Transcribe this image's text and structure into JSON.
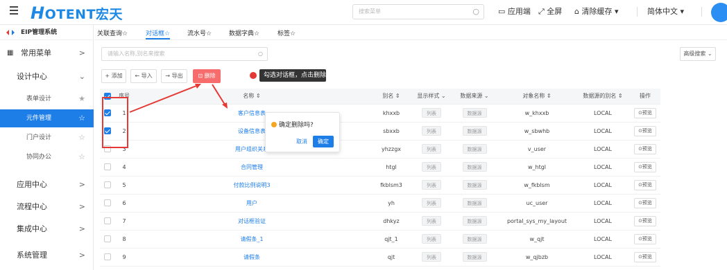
{
  "topbar": {
    "logo": "OTENT宏天",
    "logo_h": "H",
    "search_placeholder": "搜索菜单",
    "app_end": "应用端",
    "fullscreen": "全屏",
    "clear_cache": "清除缓存",
    "language": "简体中文"
  },
  "sidebar": {
    "system": "EIP管理系统",
    "common_menu": "常用菜单",
    "design_center": "设计中心",
    "items": [
      "表单设计",
      "元件管理",
      "门户设计",
      "协同办公"
    ],
    "app_center": "应用中心",
    "flow_center": "流程中心",
    "integration_center": "集成中心",
    "system_mgmt": "系统管理"
  },
  "tabs": [
    "关联查询☆",
    "对话框☆",
    "流水号☆",
    "数据字典☆",
    "标签☆"
  ],
  "toolbar": {
    "filter_placeholder": "请输入名称,别名来搜索",
    "advanced_search": "高级搜索",
    "add": "+ 添加",
    "import": "← 导入",
    "export": "→ 导出",
    "delete": "删除",
    "tooltip": "勾选对话框，点击删除"
  },
  "popconfirm": {
    "question": "确定删除吗?",
    "cancel": "取消",
    "ok": "确定"
  },
  "table": {
    "headers": [
      "序号",
      "名称 ⇕",
      "别名 ⇕",
      "显示样式 ⌄",
      "数据来源 ⌄",
      "对象名称 ⇕",
      "数据源的别名 ⇕",
      "操作"
    ],
    "rows": [
      {
        "no": "1",
        "name": "客户信息表",
        "alias": "khxxb",
        "style": "列表",
        "source": "数据源",
        "obj": "w_khxxb",
        "ds": "LOCAL",
        "op": "⊙预览",
        "checked": true
      },
      {
        "no": "2",
        "name": "设备信息表",
        "alias": "sbxxb",
        "style": "列表",
        "source": "数据源",
        "obj": "w_sbwhb",
        "ds": "LOCAL",
        "op": "⊙预览",
        "checked": true
      },
      {
        "no": "3",
        "name": "用户组织关系",
        "alias": "yhzzgx",
        "style": "列表",
        "source": "数据源",
        "obj": "v_user",
        "ds": "LOCAL",
        "op": "⊙预览",
        "checked": false
      },
      {
        "no": "4",
        "name": "合同管理",
        "alias": "htgl",
        "style": "列表",
        "source": "数据源",
        "obj": "w_htgl",
        "ds": "LOCAL",
        "op": "⊙预览",
        "checked": false
      },
      {
        "no": "5",
        "name": "付款比例说明3",
        "alias": "fkblsm3",
        "style": "列表",
        "source": "数据源",
        "obj": "w_fkblsm",
        "ds": "LOCAL",
        "op": "⊙预览",
        "checked": false
      },
      {
        "no": "6",
        "name": "用户",
        "alias": "yh",
        "style": "列表",
        "source": "数据源",
        "obj": "uc_user",
        "ds": "LOCAL",
        "op": "⊙预览",
        "checked": false
      },
      {
        "no": "7",
        "name": "对话框验证",
        "alias": "dhkyz",
        "style": "列表",
        "source": "数据源",
        "obj": "portal_sys_my_layout",
        "ds": "LOCAL",
        "op": "⊙预览",
        "checked": false
      },
      {
        "no": "8",
        "name": "请假条_1",
        "alias": "qjt_1",
        "style": "列表",
        "source": "数据源",
        "obj": "w_qjt",
        "ds": "LOCAL",
        "op": "⊙预览",
        "checked": false
      },
      {
        "no": "9",
        "name": "请假条",
        "alias": "qjt",
        "style": "列表",
        "source": "数据源",
        "obj": "w_qjbzb",
        "ds": "LOCAL",
        "op": "⊙预览",
        "checked": false
      }
    ]
  },
  "colors": {
    "accent": "#1e7ee8",
    "danger": "#f76d6d",
    "annotation": "#e53935"
  }
}
